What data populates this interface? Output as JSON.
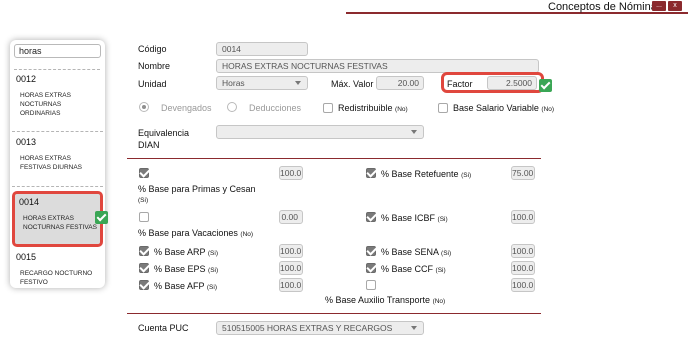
{
  "window": {
    "title": "Conceptos de Nómina",
    "minimize_label": "...",
    "close_label": "x"
  },
  "sidebar": {
    "search_value": "horas",
    "items": [
      {
        "code": "0012",
        "name": "HORAS EXTRAS NOCTURNAS ORDINARIAS"
      },
      {
        "code": "0013",
        "name": "HORAS EXTRAS FESTIVAS DIURNAS"
      },
      {
        "code": "0014",
        "name": "HORAS EXTRAS NOCTURNAS FESTIVAS"
      },
      {
        "code": "0015",
        "name": "RECARGO NOCTURNO FESTIVO"
      }
    ]
  },
  "form": {
    "codigo_label": "Código",
    "codigo_value": "0014",
    "nombre_label": "Nombre",
    "nombre_value": "HORAS EXTRAS NOCTURNAS FESTIVAS",
    "unidad_label": "Unidad",
    "unidad_value": "Horas",
    "max_valor_label": "Máx. Valor",
    "max_valor_value": "20.00",
    "factor_label": "Factor",
    "factor_value": "2.5000",
    "devengados_label": "Devengados",
    "deducciones_label": "Deducciones",
    "redistribuible_label": "Redistribuible",
    "redistribuible_no": "(No)",
    "base_salario_variable_label": "Base Salario Variable",
    "base_salario_variable_no": "(No)",
    "equivalencia_label_1": "Equivalencia",
    "equivalencia_label_2": "DIAN",
    "equivalencia_value": "",
    "primas_label": "% Base para Primas y Cesan",
    "primas_si": "(Si)",
    "primas_value": "100.0",
    "retefuente_label": "% Base Retefuente",
    "retefuente_si": "(Si)",
    "retefuente_value": "75.00",
    "vacaciones_label": "% Base para Vacaciones",
    "vacaciones_no": "(No)",
    "vacaciones_value": "0.00",
    "icbf_label": "% Base ICBF",
    "icbf_si": "(Si)",
    "icbf_value": "100.0",
    "arp_label": "% Base ARP",
    "arp_si": "(Si)",
    "arp_value": "100.0",
    "sena_label": "% Base SENA",
    "sena_si": "(Si)",
    "sena_value": "100.0",
    "eps_label": "% Base EPS",
    "eps_si": "(Si)",
    "eps_value": "100.0",
    "ccf_label": "% Base CCF",
    "ccf_si": "(Si)",
    "ccf_value": "100.0",
    "afp_label": "% Base AFP",
    "afp_si": "(Si)",
    "afp_value": "100.0",
    "auxilio_label": "% Base Auxilio Transporte",
    "auxilio_no": "(No)",
    "auxilio_value": "100.0",
    "cuenta_puc_label": "Cuenta PUC",
    "cuenta_puc_value": "510515005 HORAS EXTRAS Y RECARGOS"
  },
  "colors": {
    "accent": "#8b2a2e",
    "highlight": "#e0473e",
    "check_green": "#3aa655"
  }
}
